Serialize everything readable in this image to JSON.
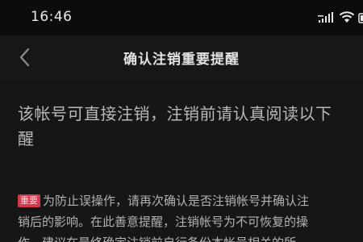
{
  "status_bar": {
    "time": "16:46"
  },
  "nav": {
    "title": "确认注销重要提醒"
  },
  "content": {
    "headline_line1": "该帐号可直接注销，注销前请认真阅读以下",
    "headline_line2": "醒",
    "badge_label": "重要",
    "notice_line1": "为防止误操作，请再次确认是否注销帐号并确认注",
    "notice_line2": "销后的影响。在此善意提醒，注销帐号为不可恢复的操",
    "notice_line3": "作，建议在最终确定注销前自行备份本帐号相关的所"
  },
  "colors": {
    "background": "#161616",
    "status_bar": "#0c0c0c",
    "badge": "#d03a4e",
    "text_primary": "#e2e2e2",
    "text_secondary": "#b9b9b9"
  },
  "icons": {
    "back": "chevron-left-icon",
    "signal": "signal-icon",
    "wifi": "wifi-icon",
    "battery": "battery-icon"
  }
}
